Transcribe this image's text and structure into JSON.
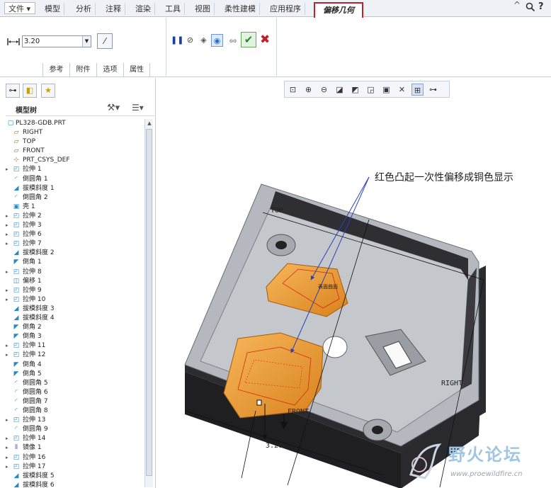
{
  "menubar": {
    "items": [
      "文件",
      "模型",
      "分析",
      "注释",
      "渲染",
      "工具",
      "视图",
      "柔性建模",
      "应用程序"
    ],
    "active_tab": "偏移几何"
  },
  "ribbon": {
    "offset_value": "3.20",
    "subtabs": [
      "参考",
      "附件",
      "选项",
      "属性"
    ]
  },
  "tree": {
    "title": "模型树",
    "root": "PL328-GDB.PRT",
    "items": [
      {
        "label": "RIGHT",
        "icon": "datum-plane",
        "exp": false
      },
      {
        "label": "TOP",
        "icon": "datum-plane",
        "exp": false
      },
      {
        "label": "FRONT",
        "icon": "datum-plane",
        "exp": false
      },
      {
        "label": "PRT_CSYS_DEF",
        "icon": "csys",
        "exp": false
      },
      {
        "label": "拉伸 1",
        "icon": "extrude",
        "exp": true
      },
      {
        "label": "倒圆角 1",
        "icon": "round",
        "exp": false
      },
      {
        "label": "拔模斜度 1",
        "icon": "draft",
        "exp": false
      },
      {
        "label": "倒圆角 2",
        "icon": "round",
        "exp": false
      },
      {
        "label": "壳 1",
        "icon": "shell",
        "exp": false
      },
      {
        "label": "拉伸 2",
        "icon": "extrude",
        "exp": true
      },
      {
        "label": "拉伸 3",
        "icon": "extrude",
        "exp": true
      },
      {
        "label": "拉伸 6",
        "icon": "extrude",
        "exp": true
      },
      {
        "label": "拉伸 7",
        "icon": "extrude",
        "exp": true
      },
      {
        "label": "拔模斜度 2",
        "icon": "draft",
        "exp": false
      },
      {
        "label": "倒角 1",
        "icon": "chamfer",
        "exp": false
      },
      {
        "label": "拉伸 8",
        "icon": "extrude",
        "exp": true
      },
      {
        "label": "偏移 1",
        "icon": "offset",
        "exp": false
      },
      {
        "label": "拉伸 9",
        "icon": "extrude",
        "exp": true
      },
      {
        "label": "拉伸 10",
        "icon": "extrude",
        "exp": true
      },
      {
        "label": "拔模斜度 3",
        "icon": "draft",
        "exp": false
      },
      {
        "label": "拔模斜度 4",
        "icon": "draft",
        "exp": false
      },
      {
        "label": "倒角 2",
        "icon": "chamfer",
        "exp": false
      },
      {
        "label": "倒角 3",
        "icon": "chamfer",
        "exp": false
      },
      {
        "label": "拉伸 11",
        "icon": "extrude",
        "exp": true
      },
      {
        "label": "拉伸 12",
        "icon": "extrude",
        "exp": true
      },
      {
        "label": "倒角 4",
        "icon": "chamfer",
        "exp": false
      },
      {
        "label": "倒角 5",
        "icon": "chamfer",
        "exp": false
      },
      {
        "label": "倒圆角 5",
        "icon": "round",
        "exp": false
      },
      {
        "label": "倒圆角 6",
        "icon": "round",
        "exp": false
      },
      {
        "label": "倒圆角 7",
        "icon": "round",
        "exp": false
      },
      {
        "label": "倒圆角 8",
        "icon": "round",
        "exp": false
      },
      {
        "label": "拉伸 13",
        "icon": "extrude",
        "exp": true
      },
      {
        "label": "倒圆角 9",
        "icon": "round",
        "exp": false
      },
      {
        "label": "拉伸 14",
        "icon": "extrude",
        "exp": true
      },
      {
        "label": "镜像 1",
        "icon": "mirror",
        "exp": true
      },
      {
        "label": "拉伸 16",
        "icon": "extrude",
        "exp": true
      },
      {
        "label": "拉伸 17",
        "icon": "extrude",
        "exp": true
      },
      {
        "label": "拔模斜度 5",
        "icon": "draft",
        "exp": false
      },
      {
        "label": "拔模斜度 6",
        "icon": "draft",
        "exp": false
      }
    ]
  },
  "viewport": {
    "annotation": "红色凸起一次性偏移成铜色显示",
    "labels": {
      "top": "TOP",
      "right": "RIGHT",
      "front": "FRONT",
      "dimension": "3.20",
      "small_note": "表面曲面"
    }
  },
  "watermark": {
    "text": "野火论坛",
    "url": "www.proewildfire.cn"
  },
  "colors": {
    "active_border": "#c0202a",
    "copper": "#f2a33a",
    "body": "#b8bcc2",
    "dark": "#2b2b2e"
  }
}
